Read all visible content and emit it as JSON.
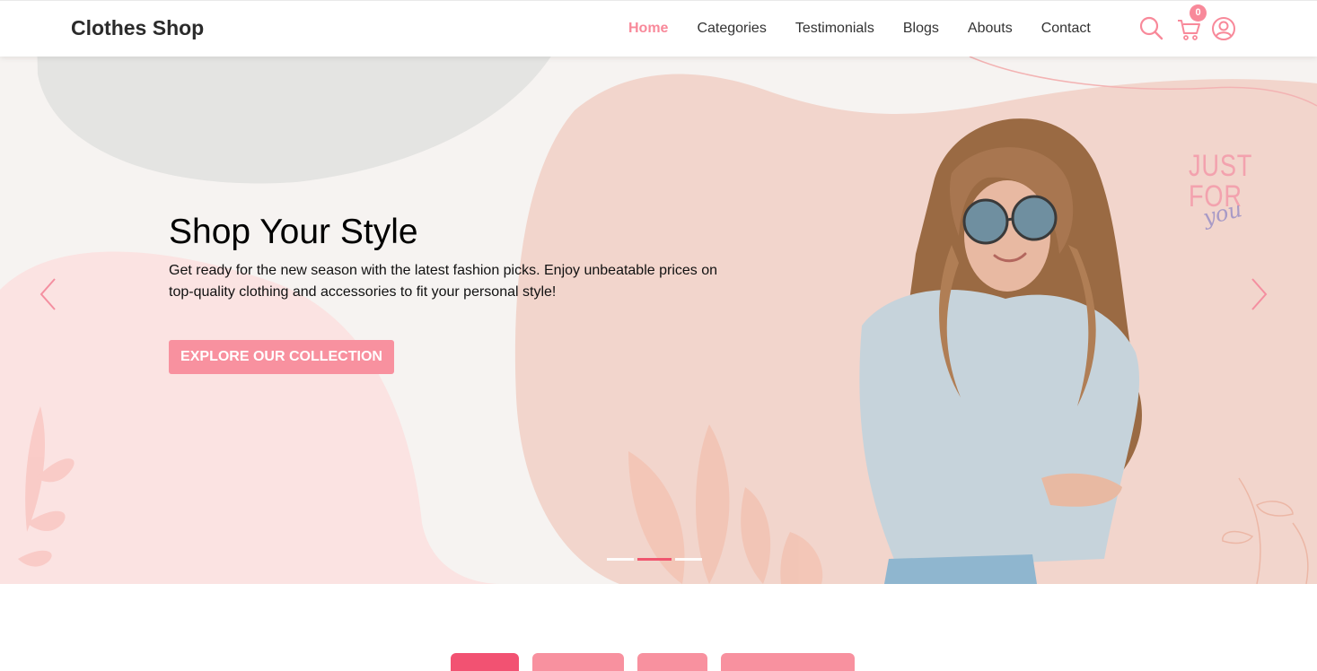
{
  "brand": "Clothes Shop",
  "nav": {
    "items": [
      "Home",
      "Categories",
      "Testimonials",
      "Blogs",
      "Abouts",
      "Contact"
    ],
    "active": "Home"
  },
  "header_icons": {
    "search": "search-icon",
    "cart": "cart-icon",
    "account": "user-circle-icon",
    "cart_count": "0"
  },
  "hero": {
    "title": "Shop Your Style",
    "description": "Get ready for the new season with the latest fashion picks. Enjoy unbeatable prices on top-quality clothing and accessories to fit your personal style!",
    "cta": "EXPLORE OUR COLLECTION",
    "promo_text": [
      "JUST",
      "FOR",
      "you"
    ],
    "slide_count": 3,
    "active_slide": 2,
    "prev_icon": "chevron-left-icon",
    "next_icon": "chevron-right-icon"
  },
  "category_tabs": {
    "count": 4,
    "active_index": 0
  },
  "colors": {
    "accent": "#f8899a",
    "accent_dark": "#f0566f",
    "button": "#f8919f",
    "text": "#2b2b2b",
    "hero_bg": "#f6f3f1"
  }
}
